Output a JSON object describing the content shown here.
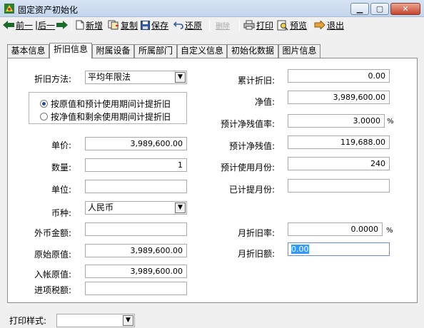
{
  "window": {
    "title": "固定资产初始化",
    "min_glyph": "▁",
    "max_glyph": "▢",
    "close_glyph": "✕"
  },
  "toolbar": {
    "prev_label": "前一",
    "next_label": "后一",
    "new_label": "新增",
    "copy_label": "复制",
    "save_label": "保存",
    "restore_label": "还原",
    "delete_label": "删除",
    "print_label": "打印",
    "preview_label": "预览",
    "exit_label": "退出"
  },
  "tabs": [
    "基本信息",
    "折旧信息",
    "附属设备",
    "所属部门",
    "自定义信息",
    "初始化数据",
    "图片信息"
  ],
  "active_tab": "折旧信息",
  "form": {
    "method_label": "折旧方法:",
    "method_value": "平均年限法",
    "radio1": "按原值和预计使用期间计提折旧",
    "radio2": "按净值和剩余使用期间计提折旧",
    "unit_price_label": "单价:",
    "unit_price": "3,989,600.00",
    "qty_label": "数量:",
    "qty": "1",
    "unit_label": "单位:",
    "unit": "",
    "currency_label": "币种:",
    "currency": "人民币",
    "foreign_amount_label": "外币金额:",
    "foreign_amount": "",
    "original_value_label": "原始原值:",
    "original_value": "3,989,600.00",
    "entry_value_label": "入帐原值:",
    "entry_value": "3,989,600.00",
    "input_tax_label": "进项税额:",
    "input_tax": "",
    "accum_dep_label": "累计折旧:",
    "accum_dep": "0.00",
    "net_value_label": "净值:",
    "net_value": "3,989,600.00",
    "residual_rate_label": "预计净残值率:",
    "residual_rate": "3.0000",
    "percent": "%",
    "residual_value_label": "预计净残值:",
    "residual_value": "119,688.00",
    "months_label": "预计使用月份:",
    "months": "240",
    "used_months_label": "已计提月份:",
    "used_months": "",
    "monthly_rate_label": "月折旧率:",
    "monthly_rate": "0.0000",
    "monthly_amount_label": "月折旧额:",
    "monthly_amount": "0.00"
  },
  "print_style_label": "打印样式:",
  "print_style_value": "",
  "colors": {
    "accent": "#3399ff",
    "titlebar": "#c3d5ec",
    "close": "#c7452d"
  }
}
